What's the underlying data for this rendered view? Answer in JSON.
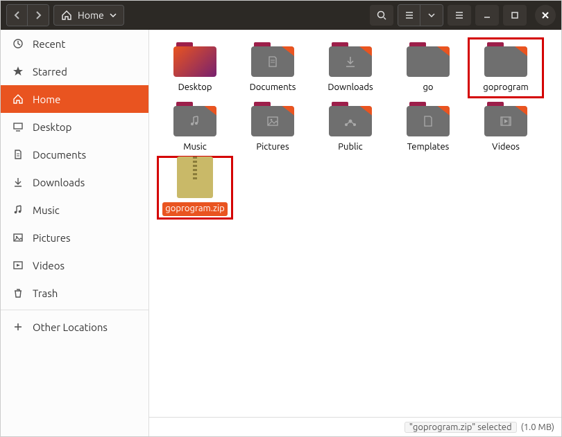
{
  "titlebar": {
    "path_label": "Home"
  },
  "sidebar": {
    "items": [
      {
        "label": "Recent",
        "icon": "clock-icon"
      },
      {
        "label": "Starred",
        "icon": "star-icon"
      },
      {
        "label": "Home",
        "icon": "home-icon",
        "active": true
      },
      {
        "label": "Desktop",
        "icon": "desktop-icon"
      },
      {
        "label": "Documents",
        "icon": "documents-icon"
      },
      {
        "label": "Downloads",
        "icon": "downloads-icon"
      },
      {
        "label": "Music",
        "icon": "music-icon"
      },
      {
        "label": "Pictures",
        "icon": "pictures-icon"
      },
      {
        "label": "Videos",
        "icon": "videos-icon"
      },
      {
        "label": "Trash",
        "icon": "trash-icon"
      }
    ],
    "other_locations": "Other Locations"
  },
  "files": [
    {
      "label": "Desktop",
      "type": "desktop"
    },
    {
      "label": "Documents",
      "type": "folder",
      "glyph": "documents"
    },
    {
      "label": "Downloads",
      "type": "folder",
      "glyph": "downloads"
    },
    {
      "label": "go",
      "type": "folder"
    },
    {
      "label": "goprogram",
      "type": "folder",
      "highlight": true
    },
    {
      "label": "Music",
      "type": "folder",
      "glyph": "music"
    },
    {
      "label": "Pictures",
      "type": "folder",
      "glyph": "pictures"
    },
    {
      "label": "Public",
      "type": "folder",
      "glyph": "public"
    },
    {
      "label": "Templates",
      "type": "folder",
      "glyph": "templates"
    },
    {
      "label": "Videos",
      "type": "folder",
      "glyph": "videos"
    },
    {
      "label": "goprogram.zip",
      "type": "zip",
      "selected": true,
      "highlight": true
    }
  ],
  "status": {
    "selected_name": "\"goprogram.zip\" selected",
    "size": "(1.0 MB)"
  }
}
